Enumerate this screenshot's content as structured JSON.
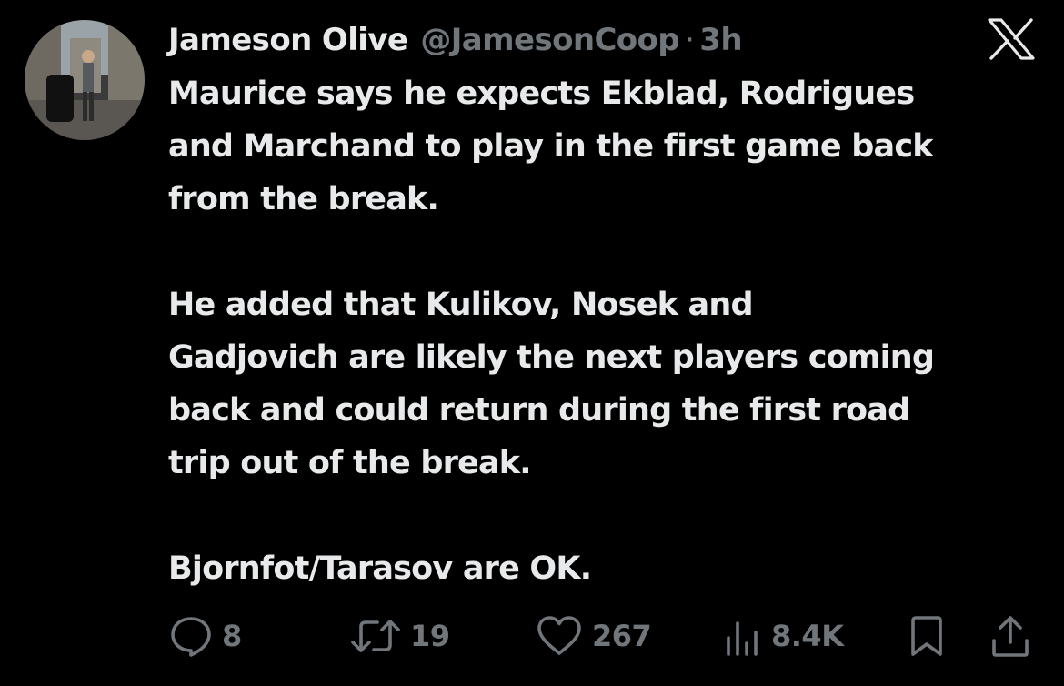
{
  "author": {
    "display_name": "Jameson Olive",
    "handle": "@JamesonCoop",
    "separator": "·",
    "time": "3h"
  },
  "platform_logo": "x-logo",
  "tweet": {
    "paragraphs": [
      [
        "Maurice says he expects Ekblad, Rodrigues",
        "and Marchand to play in the first game back",
        "from the break."
      ],
      [
        "He added that Kulikov, Nosek and",
        "Gadjovich are likely the next players coming",
        "back and could return during the first road",
        "trip out of the break."
      ],
      [
        "Bjornfot/Tarasov are OK."
      ]
    ]
  },
  "actions": {
    "replies": {
      "icon": "reply-icon",
      "count": "8"
    },
    "reposts": {
      "icon": "repost-icon",
      "count": "19"
    },
    "likes": {
      "icon": "heart-icon",
      "count": "267"
    },
    "views": {
      "icon": "views-icon",
      "count": "8.4K"
    },
    "bookmark": {
      "icon": "bookmark-icon"
    },
    "share": {
      "icon": "share-icon"
    }
  },
  "colors": {
    "background": "#000000",
    "primary_text": "#e7e9ea",
    "secondary_text": "#71767b"
  }
}
